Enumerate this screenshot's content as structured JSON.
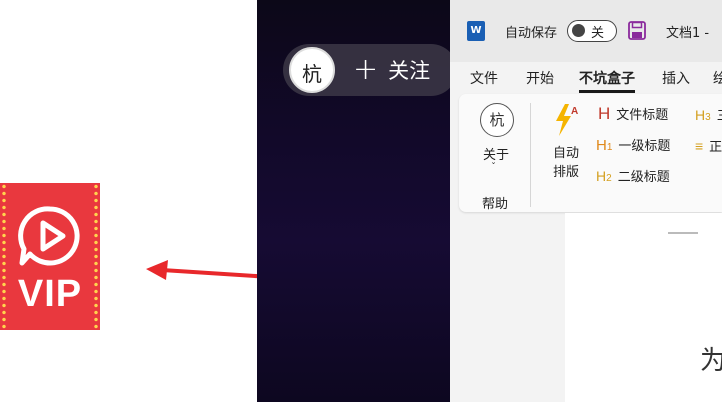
{
  "vip_badge": {
    "label": "VIP",
    "color": "#e9383e",
    "icon": "play-bubble-icon"
  },
  "arrow": {
    "color": "#e8282b"
  },
  "video": {
    "avatar_text": "杭",
    "follow_plus": "+",
    "follow_label": "关注"
  },
  "word": {
    "app_icon": "W",
    "autosave_label": "自动保存",
    "autosave_state": "关",
    "doc_title": "文档1 -",
    "tabs": [
      {
        "label": "文件",
        "active": false
      },
      {
        "label": "开始",
        "active": false
      },
      {
        "label": "不坑盒子",
        "active": true
      },
      {
        "label": "插入",
        "active": false
      },
      {
        "label": "绘",
        "active": false
      }
    ],
    "ribbon": {
      "about_logo_text": "杭",
      "about_label": "关于",
      "about_chevron": "ˇ",
      "help_group_label": "帮助",
      "auto_layout_line1": "自动",
      "auto_layout_line2": "排版",
      "heading_items": [
        {
          "marker": "H",
          "sub": "",
          "label": "文件标题"
        },
        {
          "marker": "H",
          "sub": "1",
          "label": "一级标题"
        },
        {
          "marker": "H",
          "sub": "2",
          "label": "二级标题"
        }
      ],
      "right_items": [
        {
          "marker": "H",
          "sub": "3",
          "label": "三"
        },
        {
          "marker": "≡",
          "sub": "",
          "label": "正"
        }
      ]
    },
    "doc_text": "为"
  }
}
